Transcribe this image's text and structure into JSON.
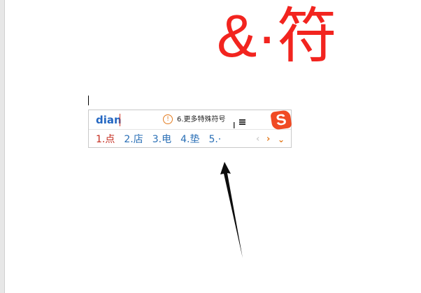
{
  "document": {
    "big_symbols": "&·符"
  },
  "ime": {
    "pinyin": "dian",
    "hint": "6.更多特殊符号",
    "info_icon": "info-icon",
    "logo_letter": "S",
    "candidates": [
      {
        "index": "1.",
        "text": "点"
      },
      {
        "index": "2.",
        "text": "店"
      },
      {
        "index": "3.",
        "text": "电"
      },
      {
        "index": "4.",
        "text": "垫"
      },
      {
        "index": "5.",
        "text": "·"
      }
    ],
    "nav": {
      "prev": "‹",
      "next": "›",
      "expand": "⌄"
    }
  },
  "colors": {
    "symbols": "#f2241f",
    "pinyin": "#2467c2",
    "candidate_first": "#c42c1f",
    "candidate": "#2a6fb6",
    "logo": "#f04a24"
  }
}
